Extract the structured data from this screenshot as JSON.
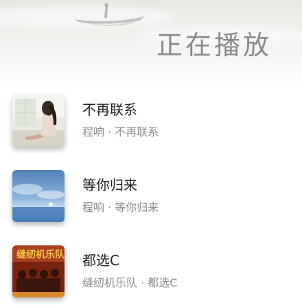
{
  "header": {
    "title": "正在播放"
  },
  "songs": [
    {
      "title": "不再联系",
      "artist": "程响",
      "album": "不再联系",
      "subtitle": "程响 · 不再联系"
    },
    {
      "title": "等你归来",
      "artist": "程响",
      "album": "等你归来",
      "subtitle": "程响 · 等你归来"
    },
    {
      "title": "都选C",
      "artist": "缝纫机乐队",
      "album": "都选C",
      "subtitle": "缝纫机乐队 · 都选C"
    }
  ],
  "icons": [
    "boat-silhouette-art"
  ],
  "colors": {
    "title": "#8a8a8a",
    "song_title": "#222222",
    "song_subtitle": "#8c8c8c",
    "background": "#ffffff"
  }
}
